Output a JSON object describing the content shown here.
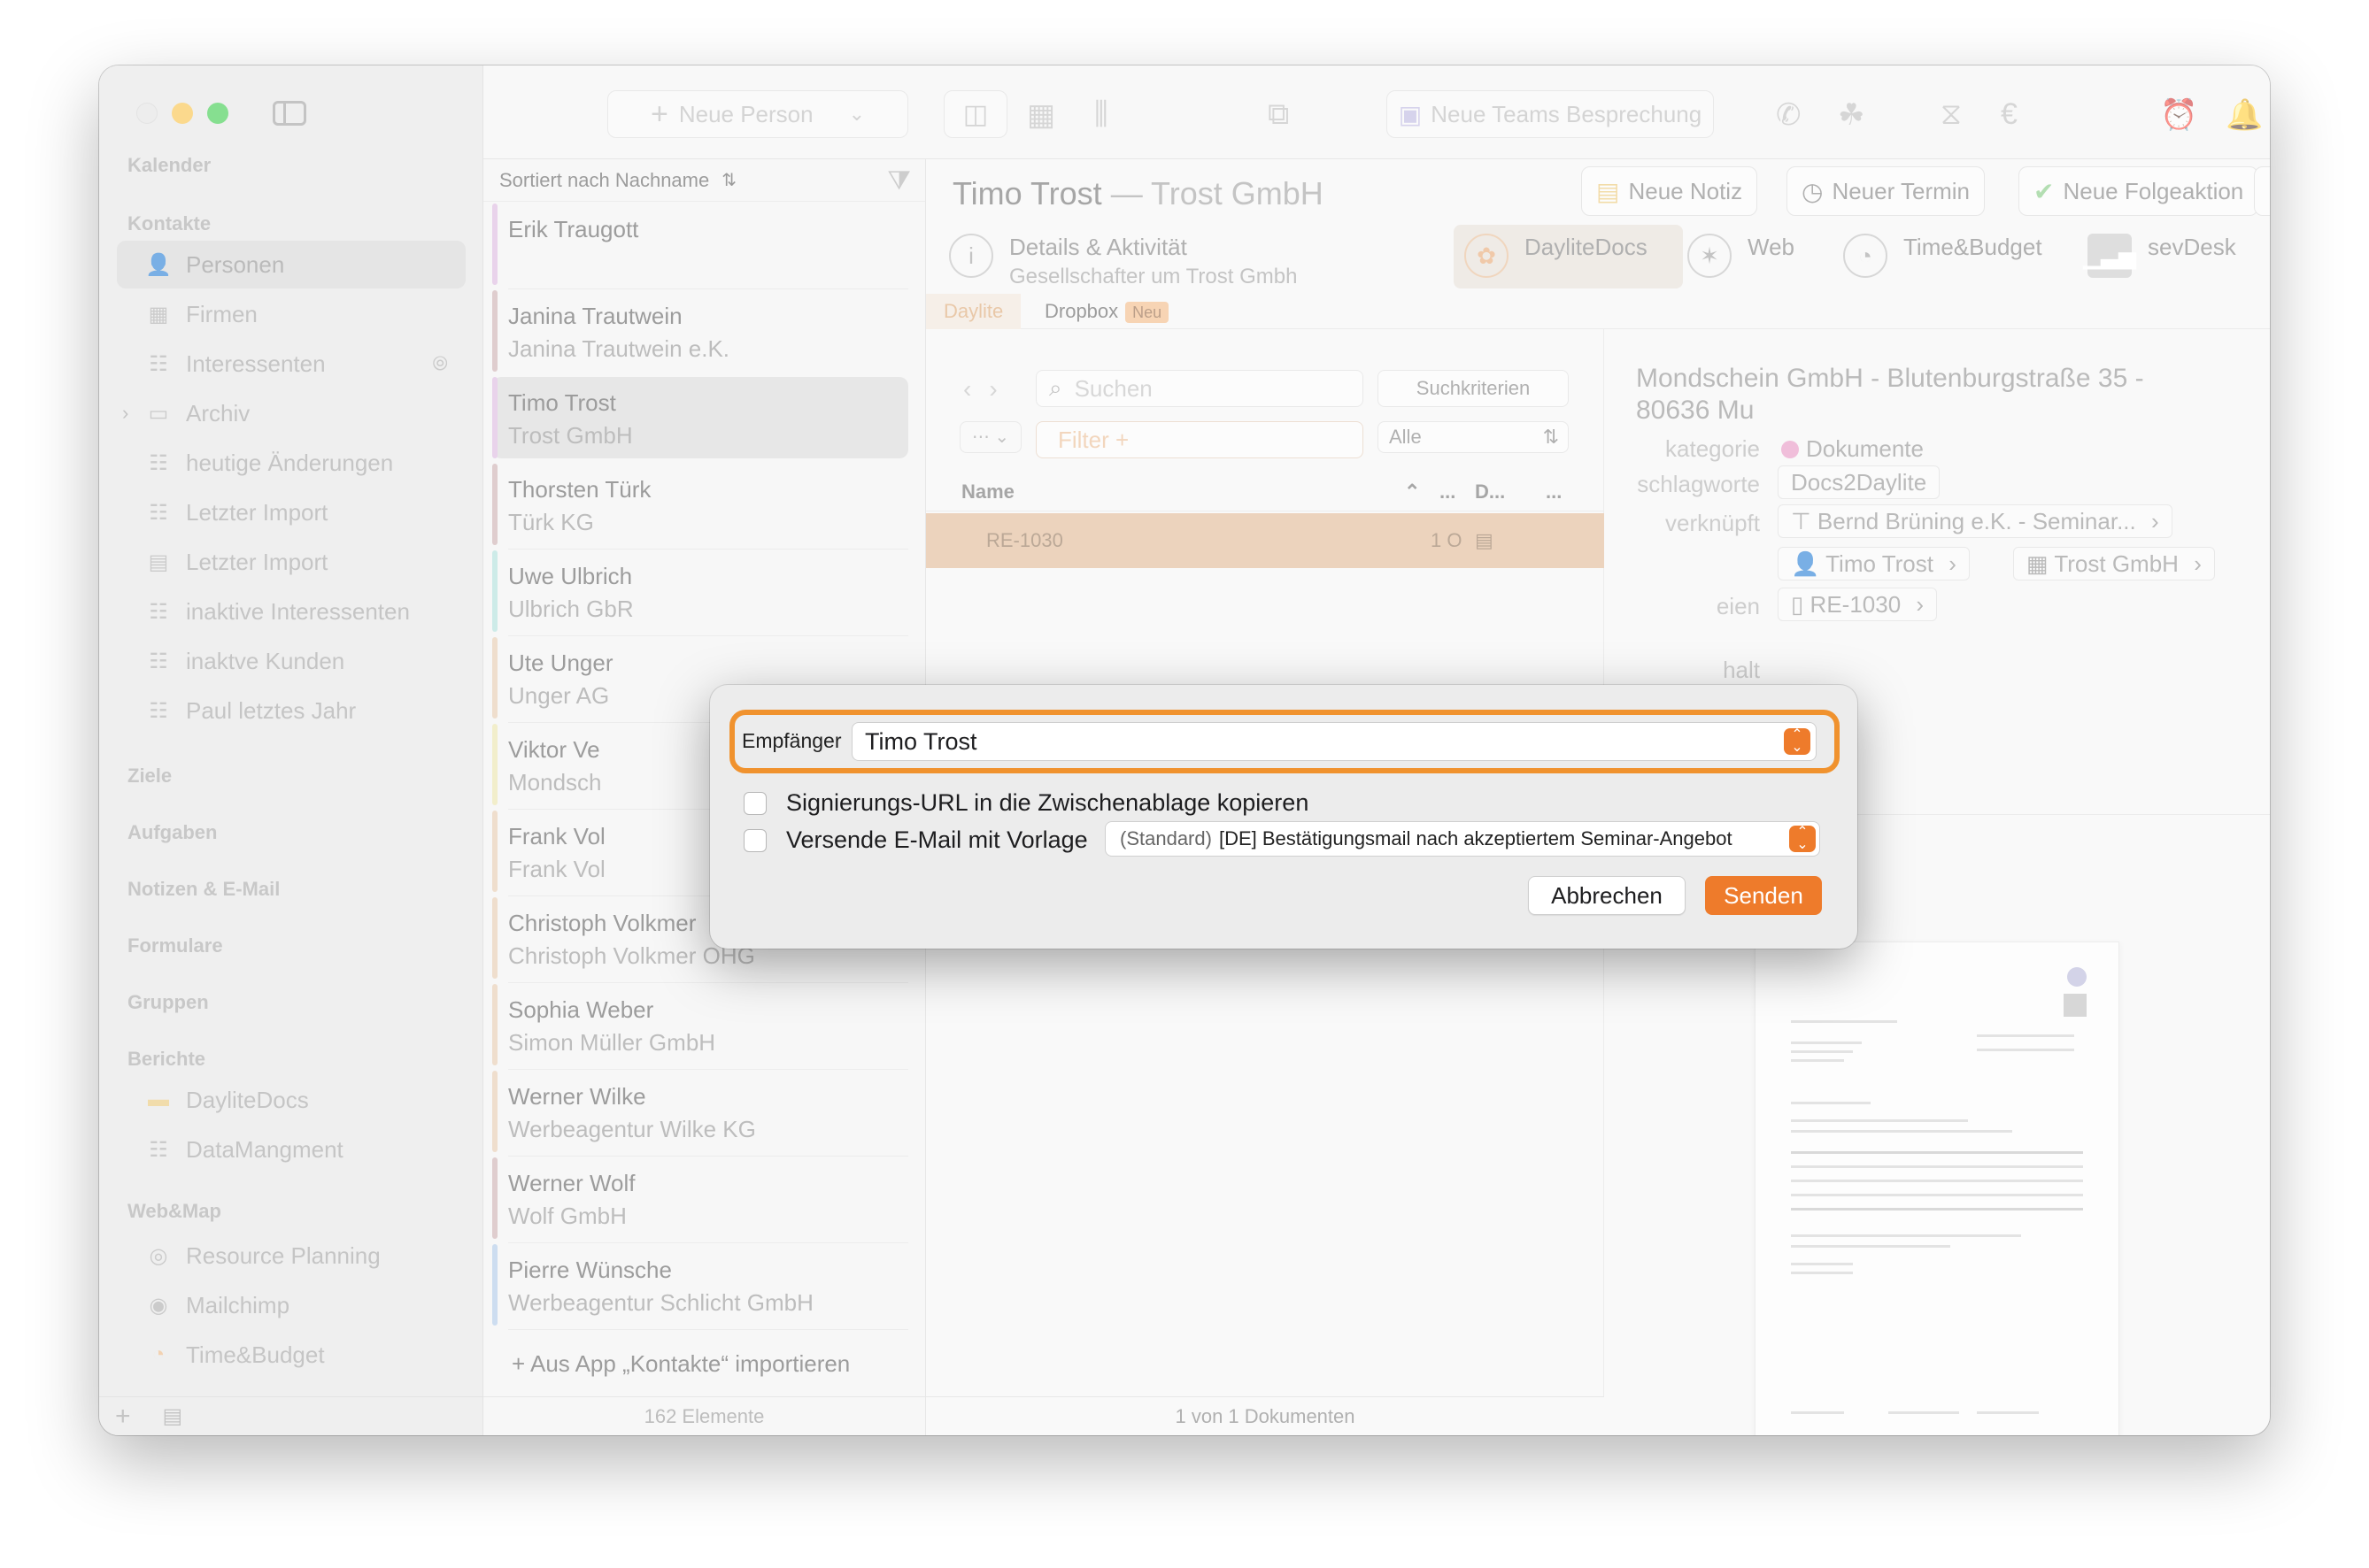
{
  "sidebar": {
    "sections": {
      "kalender": "Kalender",
      "kontakte": "Kontakte",
      "ziele": "Ziele",
      "aufgaben": "Aufgaben",
      "notizen": "Notizen & E-Mail",
      "formulare": "Formulare",
      "gruppen": "Gruppen",
      "berichte": "Berichte",
      "webmap": "Web&Map"
    },
    "items": {
      "personen": "Personen",
      "firmen": "Firmen",
      "interessenten": "Interessenten",
      "archiv": "Archiv",
      "heutige": "heutige Änderungen",
      "import1": "Letzter Import",
      "import2": "Letzter Import",
      "inaktive_int": "inaktive Interessenten",
      "inaktive_kunden": "inaktve Kunden",
      "paul": "Paul letztes Jahr",
      "daylitedocs": "DayliteDocs",
      "datamanagment": "DataMangment",
      "resource": "Resource Planning",
      "mailchimp": "Mailchimp",
      "timebudget": "Time&Budget"
    }
  },
  "toolbar": {
    "neue_person": "Neue Person",
    "teams": "Neue Teams Besprechung"
  },
  "list": {
    "sort_label": "Sortiert nach Nachname",
    "rows": [
      {
        "name": "Erik Traugott",
        "company": ""
      },
      {
        "name": "Janina Trautwein",
        "company": "Janina Trautwein e.K."
      },
      {
        "name": "Timo Trost",
        "company": "Trost GmbH"
      },
      {
        "name": "Thorsten Türk",
        "company": "Türk KG"
      },
      {
        "name": "Uwe Ulbrich",
        "company": "Ulbrich GbR"
      },
      {
        "name": "Ute Unger",
        "company": "Unger AG"
      },
      {
        "name": "Viktor Ve",
        "company": "Mondsch"
      },
      {
        "name": "Frank Vol",
        "company": "Frank Vol"
      },
      {
        "name": "Christoph Volkmer",
        "company": "Christoph Volkmer OHG"
      },
      {
        "name": "Sophia Weber",
        "company": "Simon Müller GmbH"
      },
      {
        "name": "Werner Wilke",
        "company": "Werbeagentur Wilke KG"
      },
      {
        "name": "Werner Wolf",
        "company": "Wolf GmbH"
      },
      {
        "name": "Pierre Wünsche",
        "company": "Werbeagentur Schlicht GmbH"
      }
    ],
    "import_label": "+ Aus App „Kontakte“ importieren",
    "footer": "162 Elemente"
  },
  "detail": {
    "title": "Timo Trost",
    "subtitle": "— Trost GmbH",
    "actions": {
      "notiz": "Neue Notiz",
      "termin": "Neuer Termin",
      "folge": "Neue Folgeaktion"
    },
    "tabs": {
      "details_title": "Details & Aktivität",
      "details_sub": "Gesellschafter um Trost Gmbh",
      "daylitedocs": "DayliteDocs",
      "web": "Web",
      "timebudget": "Time&Budget",
      "sevdesk": "sevDesk"
    },
    "subtabs": {
      "daylite": "Daylite",
      "dropbox": "Dropbox",
      "neu": "Neu"
    },
    "docs": {
      "search_placeholder": "Suchen",
      "criteria": "Suchkriterien",
      "filter": "Filter +",
      "alle": "Alle",
      "col_name": "Name",
      "col_d": "D...",
      "row": "RE-1030",
      "row_meta": "1 O",
      "footer": "1 von 1 Dokumenten"
    },
    "info": {
      "address": "Mondschein GmbH - Blutenburgstraße 35 - 80636 Mu",
      "kategorie_label": "kategorie",
      "kategorie_value": "Dokumente",
      "schlagworte_label": "schlagworte",
      "schlagworte_value": "Docs2Daylite",
      "verknuepft_label": "verknüpft",
      "link1": "Bernd Brüning e.K. - Seminar...",
      "link2": "Timo Trost",
      "link3": "Trost GmbH",
      "dateien_label": "eien",
      "file": "RE-1030",
      "inhalt_label": "halt"
    }
  },
  "dialog": {
    "recipient_label": "Empfänger",
    "recipient_value": "Timo Trost",
    "copy_url": "Signierungs-URL in die Zwischenablage kopieren",
    "send_mail": "Versende E-Mail mit Vorlage",
    "template_prefix": "(Standard)",
    "template_value": "[DE] Bestätigungsmail nach akzeptiertem Seminar-Angebot",
    "cancel": "Abbrechen",
    "send": "Senden"
  },
  "colors": {
    "accent": "#ee7b2b",
    "focus_ring": "#f0922e"
  }
}
